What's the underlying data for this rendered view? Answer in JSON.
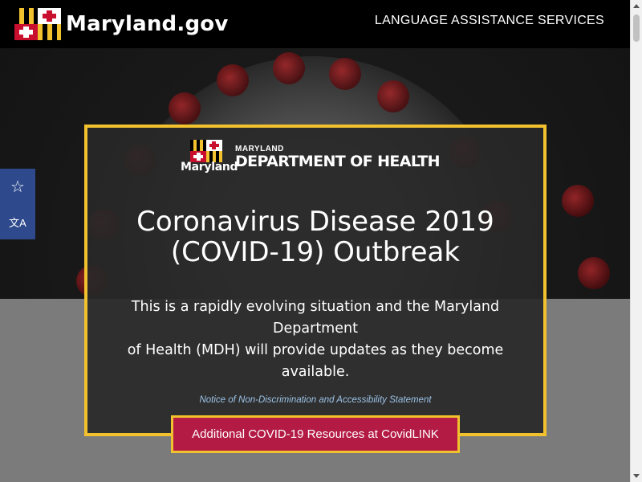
{
  "header": {
    "site_name": "Maryland.gov",
    "language_link": "LANGUAGE ASSISTANCE SERVICES",
    "logo_icon": "maryland-flag-icon"
  },
  "side_tools": [
    {
      "icon": "star-icon",
      "glyph": "☆"
    },
    {
      "icon": "translate-icon",
      "glyph": "文A"
    }
  ],
  "panel": {
    "logo": {
      "script": "Maryland",
      "small": "MARYLAND",
      "big": "DEPARTMENT OF HEALTH"
    },
    "title_line1": "Coronavirus Disease 2019",
    "title_line2": "(COVID-19) Outbreak",
    "desc_line1": "This is a rapidly evolving situation and the Maryland",
    "desc_line2": "Department",
    "desc_line3": "of Health (MDH) will provide updates as they become",
    "desc_line4": "available.",
    "notice_link": "Notice of Non-Discrimination and Accessibility Statement"
  },
  "cta": {
    "label": "Additional COVID-19 Resources at CovidLINK"
  },
  "colors": {
    "accent_border": "#f2c12e",
    "cta_bg": "#b31b45",
    "side_tools_bg": "#2e4a8c",
    "topbar_bg": "#000000"
  }
}
